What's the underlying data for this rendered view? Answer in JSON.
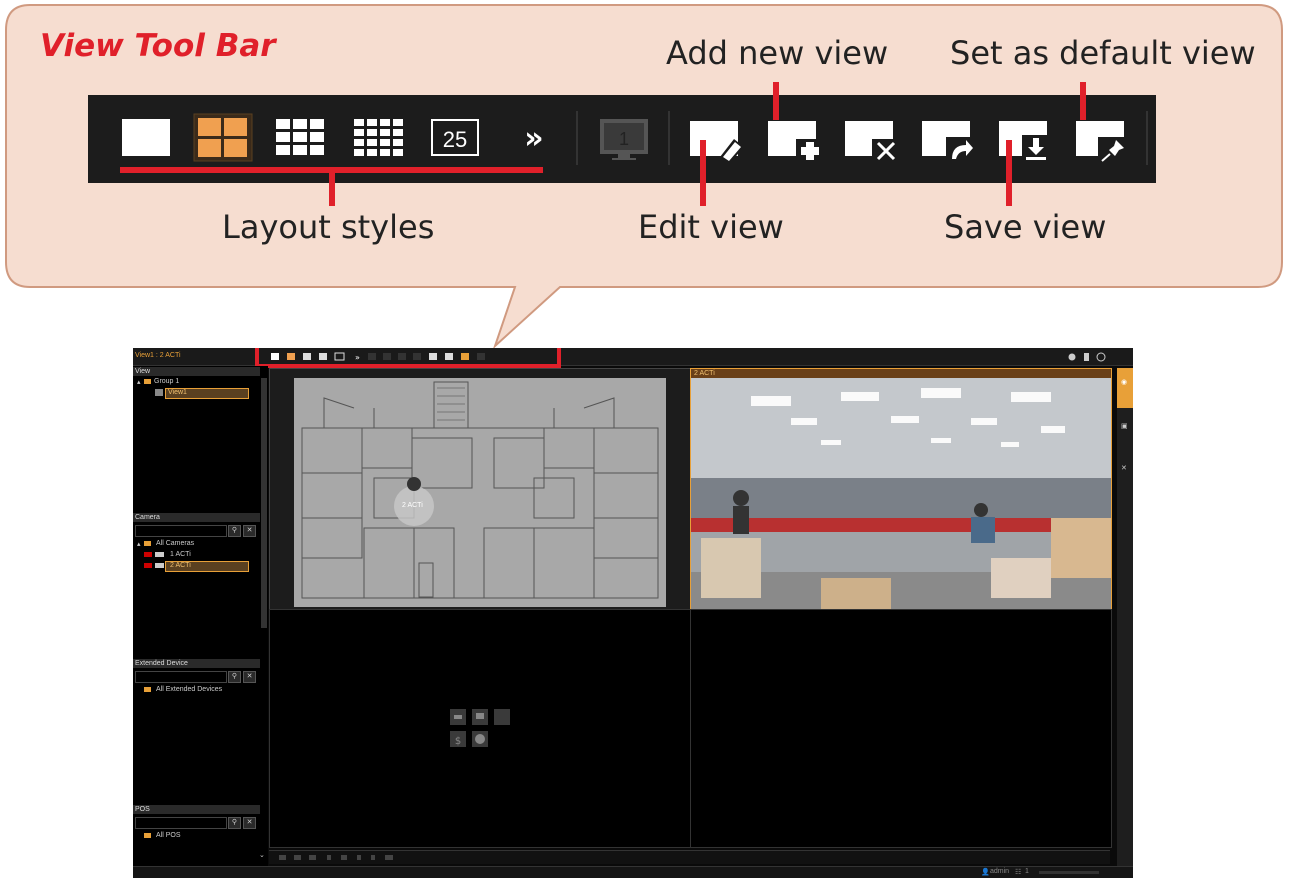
{
  "callout": {
    "title": "View Tool Bar",
    "labels": {
      "add_new_view": "Add new view",
      "set_default_view": "Set as default view",
      "layout_styles": "Layout styles",
      "edit_view": "Edit view",
      "save_view": "Save view"
    },
    "toolbar_buttons": [
      {
        "name": "layout-1x1-icon"
      },
      {
        "name": "layout-2x2-icon"
      },
      {
        "name": "layout-3x3-icon"
      },
      {
        "name": "layout-4x4-icon"
      },
      {
        "name": "layout-25-icon",
        "label": "25"
      },
      {
        "name": "more-layouts-icon",
        "label": "»"
      },
      {
        "name": "monitor-icon",
        "label": "1"
      },
      {
        "name": "edit-view-icon"
      },
      {
        "name": "add-view-icon"
      },
      {
        "name": "delete-view-icon"
      },
      {
        "name": "share-view-icon"
      },
      {
        "name": "save-view-icon"
      },
      {
        "name": "pin-default-icon"
      }
    ]
  },
  "app": {
    "title": "View1 : 2 ACTi",
    "panels": {
      "view": {
        "header": "View",
        "group": "Group 1",
        "item": "View1"
      },
      "camera": {
        "header": "Camera",
        "root": "All Cameras",
        "items": [
          "1 ACTi",
          "2 ACTi"
        ]
      },
      "extended": {
        "header": "Extended Device",
        "root": "All Extended Devices"
      },
      "pos": {
        "header": "POS",
        "root": "All POS"
      }
    },
    "map_label": "2 ACTi",
    "camera_title": "2 ACTi",
    "status_user": "admin",
    "status_count": "1",
    "colors": {
      "accent": "#e8a038",
      "red": "#e0202a",
      "toolbar": "#1c1c1c",
      "callout_bg": "#f6ddd0",
      "callout_border": "#d09a80"
    }
  }
}
